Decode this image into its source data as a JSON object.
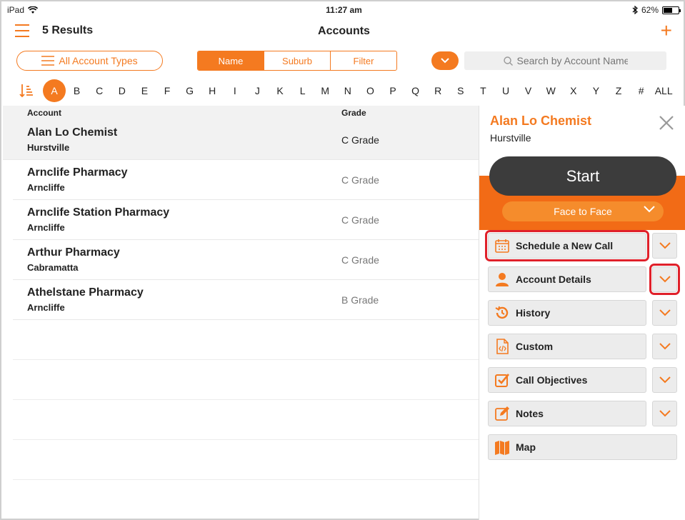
{
  "status": {
    "carrier": "iPad",
    "time": "11:27 am",
    "battery": "62%",
    "battery_level": 0.62
  },
  "header": {
    "results": "5 Results",
    "title": "Accounts"
  },
  "toolbar": {
    "account_types": "All Account Types",
    "segments": [
      "Name",
      "Suburb",
      "Filter"
    ],
    "active_segment": "Name",
    "search_placeholder": "Search by Account Name"
  },
  "alphabet": [
    "A",
    "B",
    "C",
    "D",
    "E",
    "F",
    "G",
    "H",
    "I",
    "J",
    "K",
    "L",
    "M",
    "N",
    "O",
    "P",
    "Q",
    "R",
    "S",
    "T",
    "U",
    "V",
    "W",
    "X",
    "Y",
    "Z",
    "#",
    "ALL"
  ],
  "active_letter": "A",
  "list": {
    "columns": [
      "Account",
      "Grade"
    ],
    "rows": [
      {
        "name": "Alan Lo Chemist",
        "suburb": "Hurstville",
        "grade": "C Grade"
      },
      {
        "name": "Arnclife Pharmacy",
        "suburb": "Arncliffe",
        "grade": "C Grade"
      },
      {
        "name": "Arnclife Station Pharmacy",
        "suburb": "Arncliffe",
        "grade": "C Grade"
      },
      {
        "name": "Arthur Pharmacy",
        "suburb": "Cabramatta",
        "grade": "C Grade"
      },
      {
        "name": "Athelstane Pharmacy",
        "suburb": "Arncliffe",
        "grade": "B Grade"
      }
    ]
  },
  "panel": {
    "name": "Alan Lo Chemist",
    "suburb": "Hurstville",
    "start": "Start",
    "call_type": "Face to Face",
    "items": [
      {
        "label": "Schedule a New Call",
        "icon": "calendar-icon"
      },
      {
        "label": "Account Details",
        "icon": "person-icon"
      },
      {
        "label": "History",
        "icon": "history-icon"
      },
      {
        "label": "Custom",
        "icon": "code-file-icon"
      },
      {
        "label": "Call Objectives",
        "icon": "checkbox-icon"
      },
      {
        "label": "Notes",
        "icon": "edit-icon"
      },
      {
        "label": "Map",
        "icon": "map-icon"
      }
    ]
  },
  "colors": {
    "accent": "#f47a20",
    "band": "#f26b16",
    "start": "#3c3c3c",
    "highlight": "#e0202a"
  }
}
